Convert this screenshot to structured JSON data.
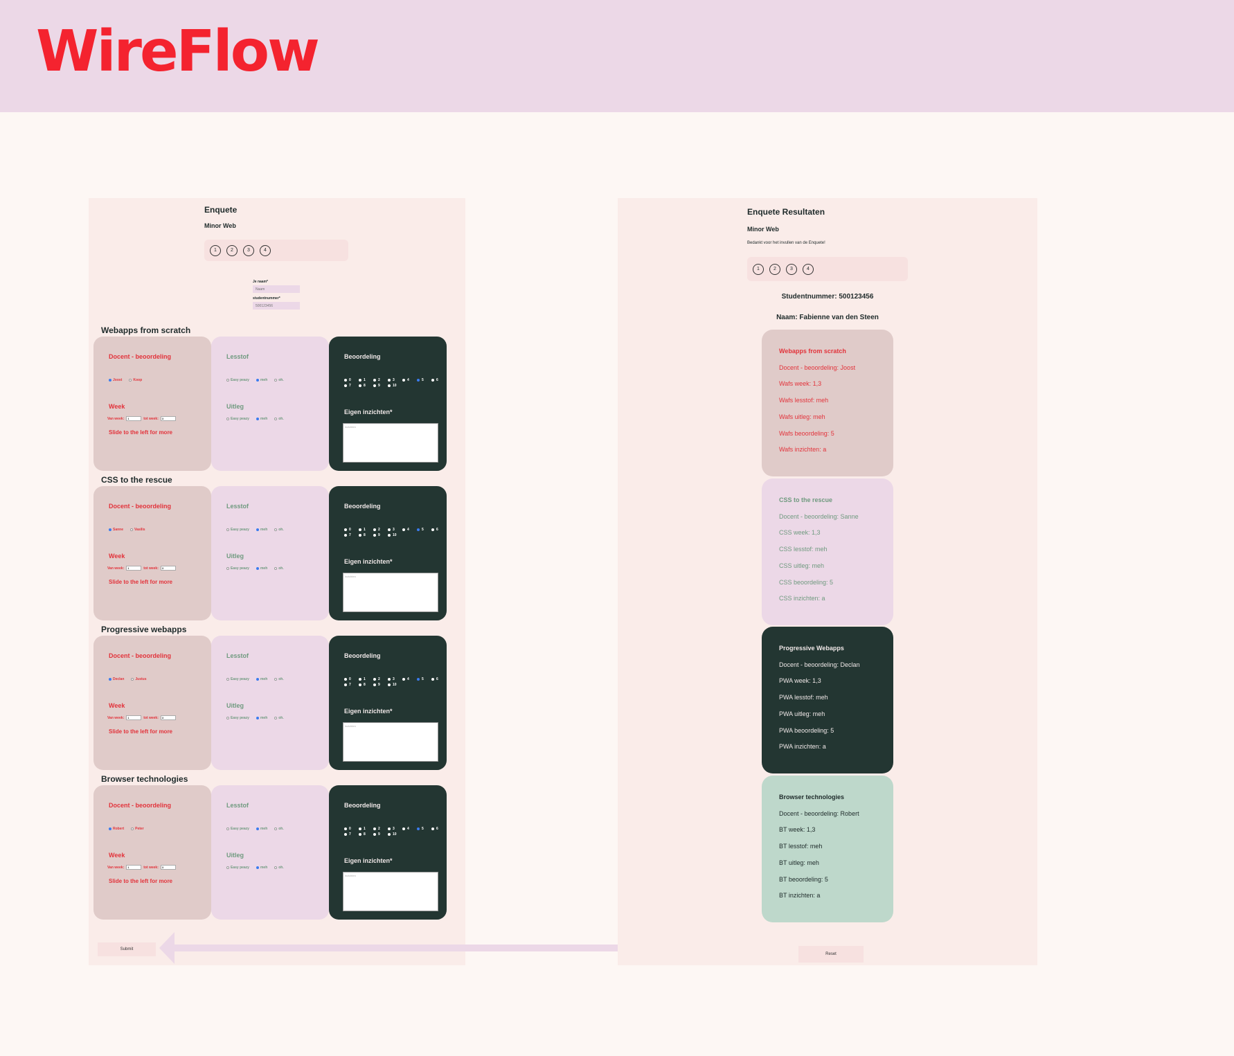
{
  "logo": "WireFlow",
  "survey": {
    "title": "Enquete",
    "subtitle": "Minor Web",
    "steps": [
      "1",
      "2",
      "3",
      "4"
    ],
    "name_label": "Je naam*",
    "name_placeholder": "Naam",
    "student_label": "studentnummer*",
    "student_placeholder": "500123456",
    "card_labels": {
      "docent": "Docent - beoordeling",
      "week": "Week",
      "van_week": "Van week:",
      "tot_week": "tot week:",
      "slide_hint": "Slide to the left for more",
      "lesstof": "Lesstof",
      "uitleg": "Uitleg",
      "options": [
        "Easy peazy",
        "meh",
        "oh."
      ],
      "beoordeling": "Beoordeling",
      "grades": [
        "0",
        "1",
        "2",
        "3",
        "4",
        "5",
        "6",
        "7",
        "8",
        "9",
        "10"
      ],
      "inzichten": "Eigen inzichten*",
      "inzichten_placeholder": "inzichten",
      "van_value": "1",
      "tot_value": "3"
    },
    "sections": [
      {
        "title": "Webapps from scratch",
        "teachers": [
          "Joost",
          "Koop"
        ]
      },
      {
        "title": "CSS to the rescue",
        "teachers": [
          "Sanne",
          "Vasilis"
        ]
      },
      {
        "title": "Progressive webapps",
        "teachers": [
          "Declan",
          "Justus"
        ]
      },
      {
        "title": "Browser technologies",
        "teachers": [
          "Robert",
          "Peter"
        ]
      }
    ],
    "submit": "Submit"
  },
  "results": {
    "title": "Enquete Resultaten",
    "subtitle": "Minor Web",
    "thanks": "Bedankt voor het invullen van de Enquete!",
    "steps": [
      "1",
      "2",
      "3",
      "4"
    ],
    "student": "Studentnummer: 500123456",
    "name": "Naam: Fabienne van den Steen",
    "cards": [
      {
        "lines": [
          "Webapps from scratch",
          "Docent - beoordeling: Joost",
          "Wafs week: 1,3",
          "Wafs lesstof: meh",
          "Wafs uitleg: meh",
          "Wafs beoordeling: 5",
          "Wafs inzichten: a"
        ]
      },
      {
        "lines": [
          "CSS to the rescue",
          "Docent - beoordeling: Sanne",
          "CSS week: 1,3",
          "CSS lesstof: meh",
          "CSS uitleg: meh",
          "CSS beoordeling: 5",
          "CSS inzichten: a"
        ]
      },
      {
        "lines": [
          "Progressive Webapps",
          "Docent - beoordeling: Declan",
          "PWA week: 1,3",
          "PWA lesstof: meh",
          "PWA uitleg: meh",
          "PWA beoordeling: 5",
          "PWA inzichten: a"
        ]
      },
      {
        "lines": [
          "Browser technologies",
          "Docent - beoordeling: Robert",
          "BT week: 1,3",
          "BT lesstof: meh",
          "BT uitleg: meh",
          "BT beoordeling: 5",
          "BT inzichten: a"
        ]
      }
    ],
    "reset": "Reset"
  },
  "colors": {
    "accent": "#f4232f",
    "header_bg": "#ecd8e7",
    "dark_card": "#233632",
    "mint_card": "#bed8cb",
    "selected_radio": "#3b7cf0"
  }
}
